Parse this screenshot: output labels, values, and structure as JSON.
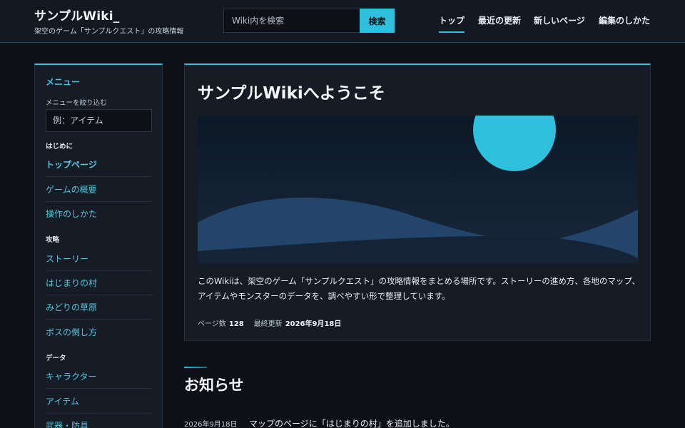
{
  "header": {
    "title": "サンプルWiki_",
    "subtitle": "架空のゲーム「サンプルクエスト」の攻略情報",
    "search_placeholder": "Wiki内を検索",
    "search_button": "検索",
    "nav": [
      {
        "label": "トップ",
        "active": true
      },
      {
        "label": "最近の更新",
        "active": false
      },
      {
        "label": "新しいページ",
        "active": false
      },
      {
        "label": "編集のしかた",
        "active": false
      }
    ]
  },
  "sidebar": {
    "title": "メニュー",
    "filter_label": "メニューを絞り込む",
    "filter_placeholder": "例：アイテム",
    "sections": [
      {
        "label": "はじめに",
        "items": [
          "トップページ",
          "ゲームの概要",
          "操作のしかた"
        ]
      },
      {
        "label": "攻略",
        "items": [
          "ストーリー",
          "はじまりの村",
          "みどりの草原",
          "ボスの倒し方"
        ]
      },
      {
        "label": "データ",
        "items": [
          "キャラクター",
          "アイテム",
          "武器・防具"
        ]
      }
    ]
  },
  "main": {
    "welcome_title": "サンプルWikiへようこそ",
    "description": "このWikiは、架空のゲーム「サンプルクエスト」の攻略情報をまとめる場所です。ストーリーの進め方、各地のマップ、アイテムやモンスターのデータを、調べやすい形で整理しています。",
    "page_count_label": "ページ数",
    "page_count": "128",
    "last_updated_label": "最終更新",
    "last_updated": "2026年9月18日"
  },
  "news": {
    "title": "お知らせ",
    "items": [
      {
        "date": "2026年9月18日",
        "text": "マップのページに「はじまりの村」を追加しました。"
      }
    ]
  },
  "colors": {
    "accent": "#2ec0dd",
    "background": "#0d1117",
    "panel": "#151c25",
    "link": "#52c6e0"
  }
}
